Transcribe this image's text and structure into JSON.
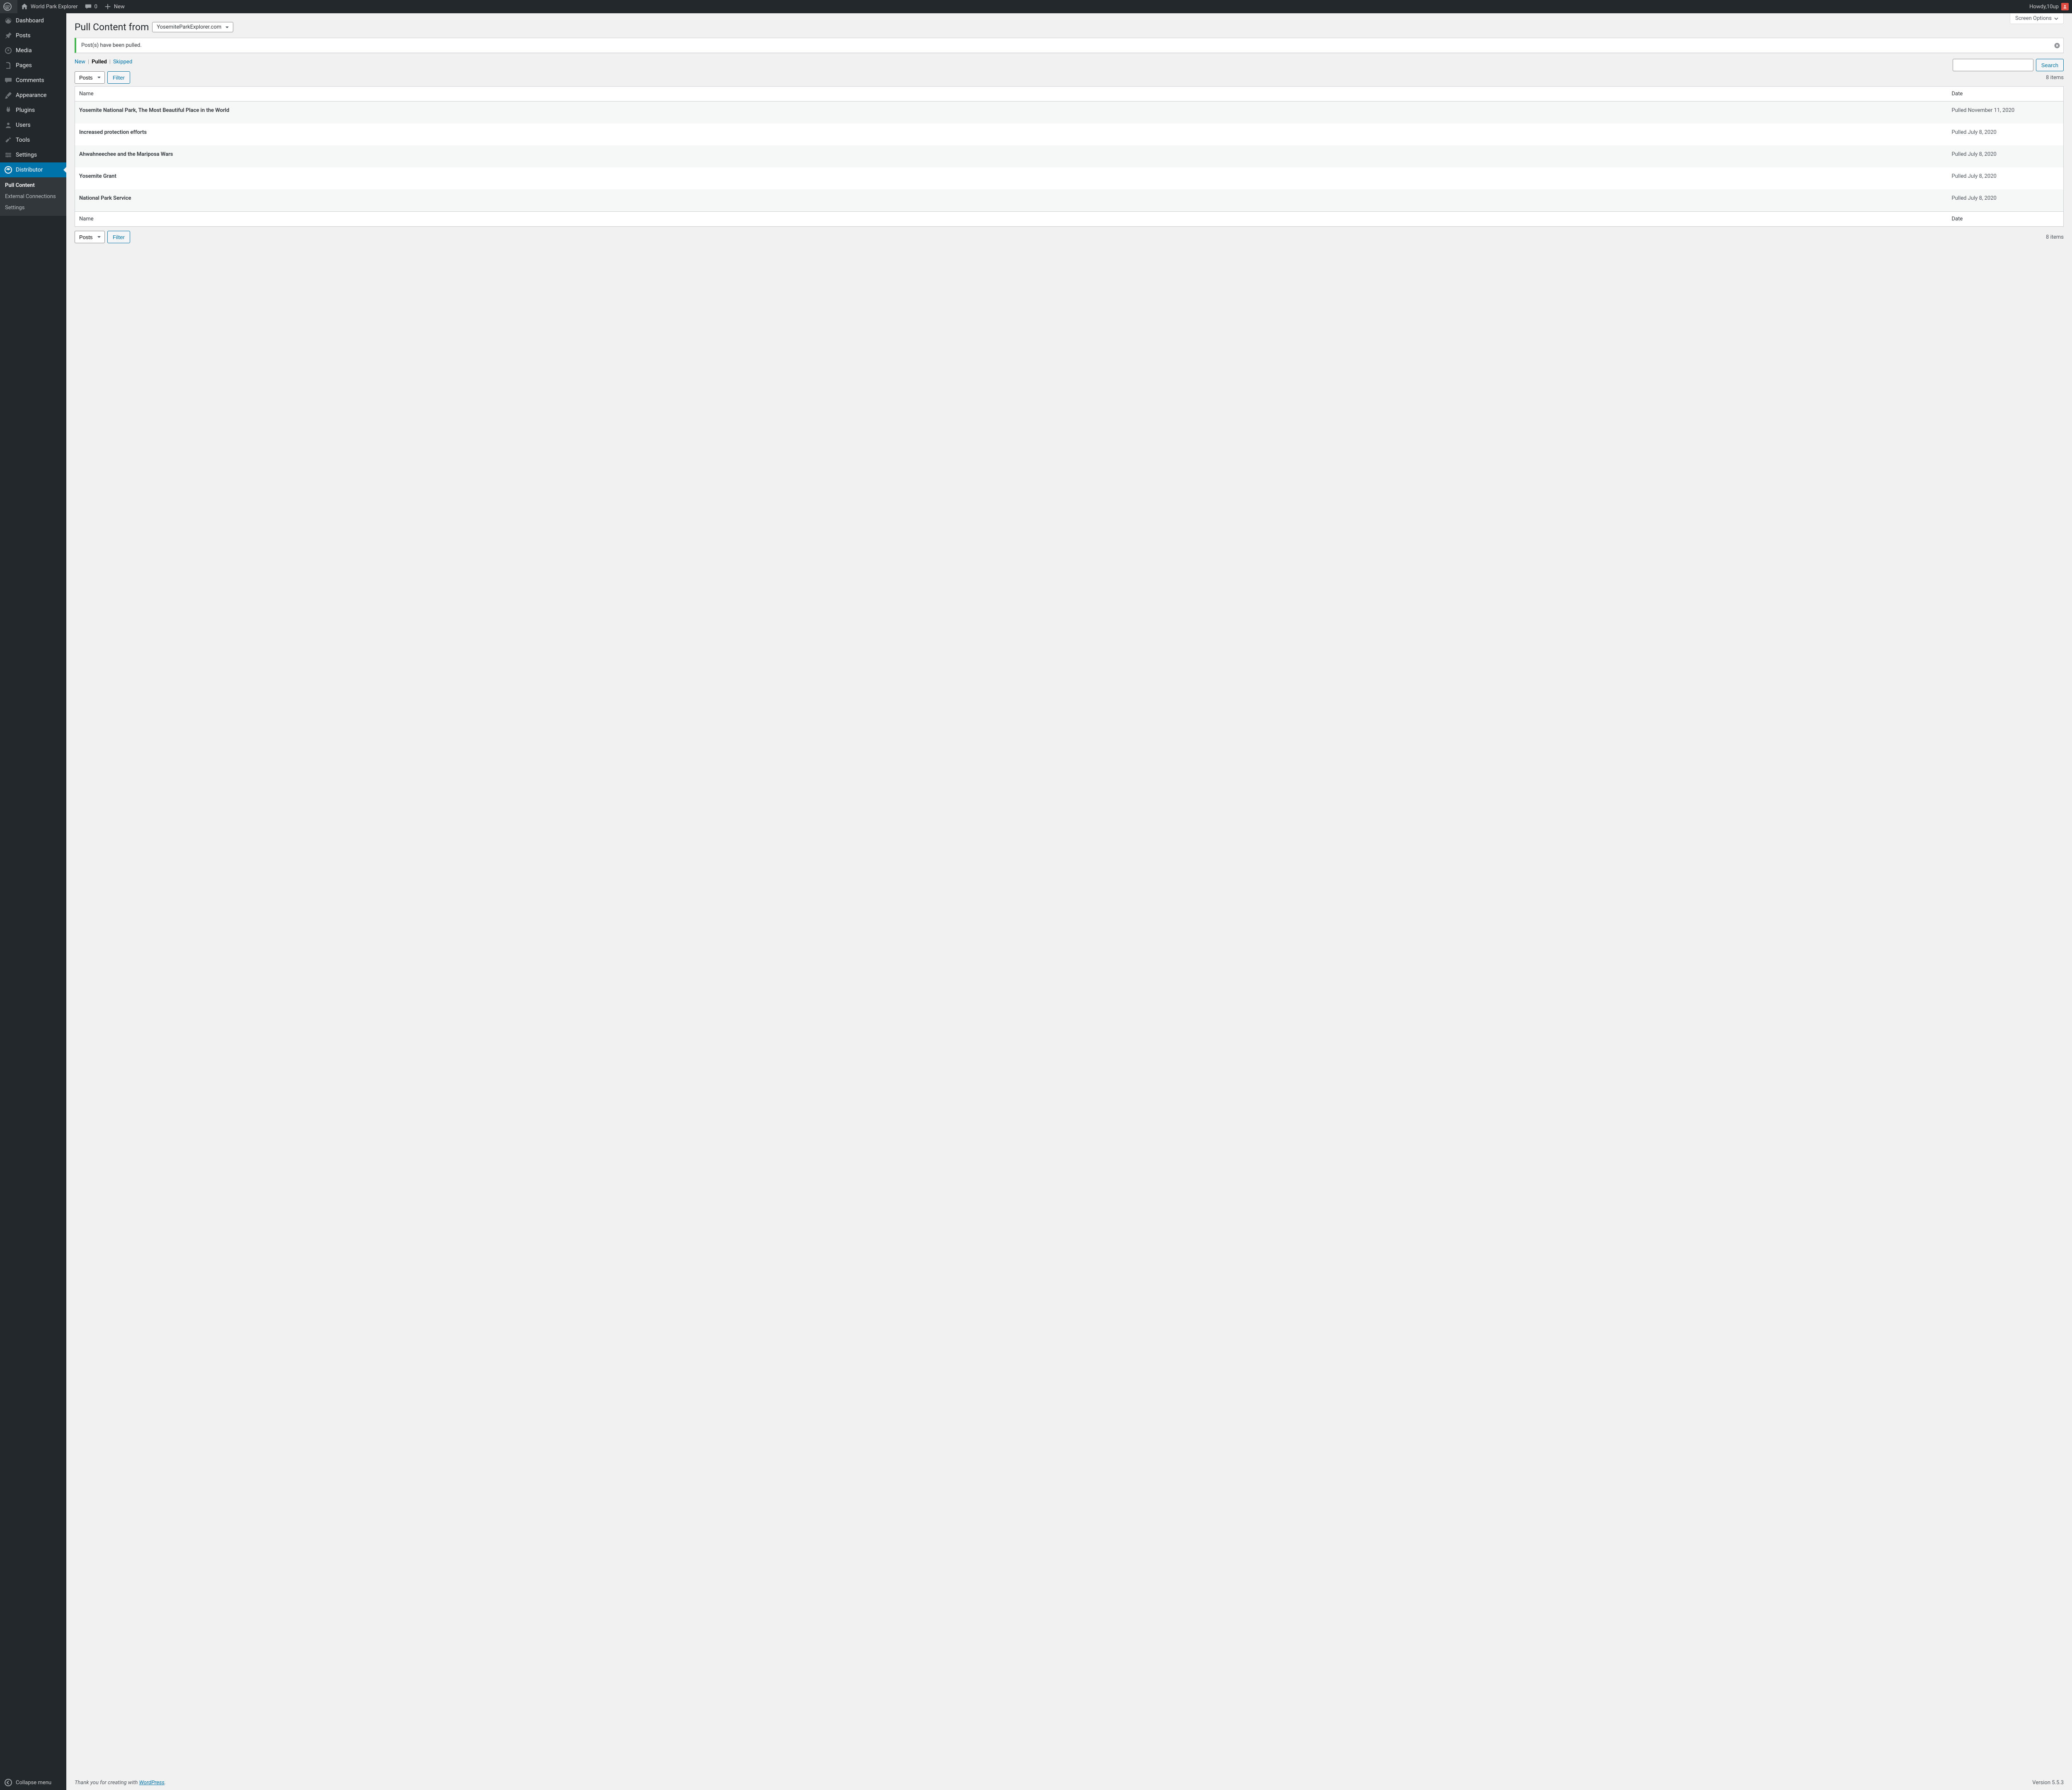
{
  "admin_bar": {
    "site_title": "World Park Explorer",
    "comments_count": "0",
    "new_label": "New",
    "howdy_prefix": "Howdy, ",
    "username": "10up"
  },
  "sidebar": {
    "items": [
      {
        "label": "Dashboard"
      },
      {
        "label": "Posts"
      },
      {
        "label": "Media"
      },
      {
        "label": "Pages"
      },
      {
        "label": "Comments"
      },
      {
        "label": "Appearance"
      },
      {
        "label": "Plugins"
      },
      {
        "label": "Users"
      },
      {
        "label": "Tools"
      },
      {
        "label": "Settings"
      },
      {
        "label": "Distributor"
      }
    ],
    "submenu": [
      {
        "label": "Pull Content"
      },
      {
        "label": "External Connections"
      },
      {
        "label": "Settings"
      }
    ],
    "collapse_label": "Collapse menu"
  },
  "screen_options_label": "Screen Options",
  "page_title": "Pull Content from",
  "selected_site": "YosemiteParkExplorer.com",
  "notice_text": "Post(s) have been pulled.",
  "status_tabs": {
    "new": "New",
    "pulled": "Pulled",
    "skipped": "Skipped"
  },
  "post_type_options": [
    "Posts"
  ],
  "selected_post_type": "Posts",
  "filter_label": "Filter",
  "search_button_label": "Search",
  "items_count": "8 items",
  "table": {
    "columns": {
      "name": "Name",
      "date": "Date"
    },
    "rows": [
      {
        "name": "Yosemite National Park, The Most Beautiful Place in the World",
        "date": "Pulled November 11, 2020"
      },
      {
        "name": "Increased protection efforts",
        "date": "Pulled July 8, 2020"
      },
      {
        "name": "Ahwahneechee and the Mariposa Wars",
        "date": "Pulled July 8, 2020"
      },
      {
        "name": "Yosemite Grant",
        "date": "Pulled July 8, 2020"
      },
      {
        "name": "National Park Service",
        "date": "Pulled July 8, 2020"
      }
    ]
  },
  "footer": {
    "thankyou_prefix": "Thank you for creating with ",
    "wordpress_link": "WordPress",
    "period": ".",
    "version": "Version 5.5.3"
  }
}
